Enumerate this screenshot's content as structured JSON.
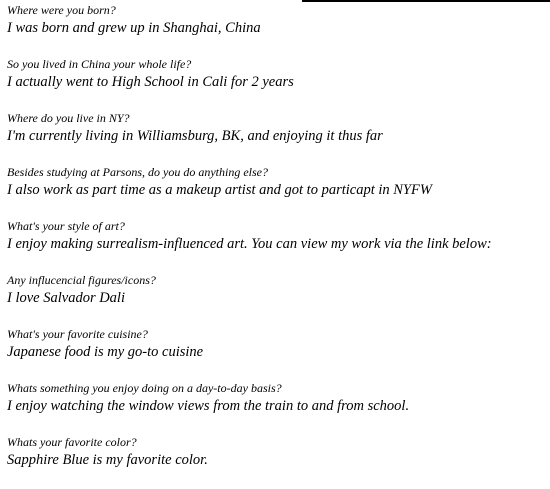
{
  "interview": [
    {
      "question": "Where were you born?",
      "answer": "I was born and grew up in Shanghai, China"
    },
    {
      "question": "So you lived in China your whole life?",
      "answer": "I actually went to High School in Cali for 2 years"
    },
    {
      "question": "Where do you live in NY?",
      "answer": "I'm currently living in Williamsburg, BK, and enjoying it thus far"
    },
    {
      "question": "Besides studying at Parsons, do you do anything else?",
      "answer": "I also work as part time as a makeup artist and got to particapt in NYFW"
    },
    {
      "question": "What's your style of art?",
      "answer": "I enjoy making surrealism-influenced art. You can view my work via the link below:"
    },
    {
      "question": "Any influcencial figures/icons?",
      "answer": "I love Salvador Dali"
    },
    {
      "question": "What's your favorite cuisine?",
      "answer": "Japanese food is my go-to cuisine"
    },
    {
      "question": "Whats something you enjoy doing on a day-to-day basis?",
      "answer": "I enjoy watching the window views from the train to and from school."
    },
    {
      "question": "Whats your favorite color?",
      "answer": "Sapphire Blue is my favorite color."
    }
  ]
}
